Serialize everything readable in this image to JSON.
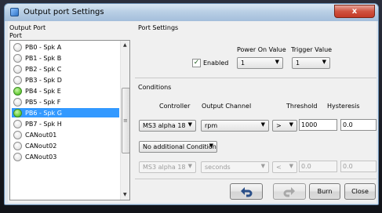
{
  "window": {
    "title": "Output port Settings",
    "close_glyph": "x"
  },
  "left": {
    "section_label": "Output Port",
    "list_label": "Port",
    "items": [
      {
        "label": "PB0 - Spk A",
        "active": false,
        "selected": false
      },
      {
        "label": "PB1 - Spk B",
        "active": false,
        "selected": false
      },
      {
        "label": "PB2 - Spk C",
        "active": false,
        "selected": false
      },
      {
        "label": "PB3 - Spk D",
        "active": false,
        "selected": false
      },
      {
        "label": "PB4 - Spk E",
        "active": true,
        "selected": false
      },
      {
        "label": "PB5 - Spk F",
        "active": false,
        "selected": false
      },
      {
        "label": "PB6 - Spk G",
        "active": true,
        "selected": true
      },
      {
        "label": "PB7 - Spk H",
        "active": false,
        "selected": false
      },
      {
        "label": "CANout01",
        "active": false,
        "selected": false
      },
      {
        "label": "CANout02",
        "active": false,
        "selected": false
      },
      {
        "label": "CANout03",
        "active": false,
        "selected": false
      }
    ],
    "scroll_up": "▲",
    "scroll_down": "▼",
    "scroll_grip": "≡"
  },
  "port_settings": {
    "section_label": "Port Settings",
    "power_on_label": "Power On Value",
    "trigger_label": "Trigger Value",
    "enabled_label": "Enabled",
    "enabled_checked": true,
    "power_on_value": "1",
    "trigger_value": "1"
  },
  "conditions": {
    "section_label": "Conditions",
    "col_controller": "Controller",
    "col_output_channel": "Output Channel",
    "col_threshold": "Threshold",
    "col_hysteresis": "Hysteresis",
    "row1": {
      "controller": "MS3 alpha 18",
      "channel": "rpm",
      "operator": ">",
      "threshold": "1000",
      "hysteresis": "0.0"
    },
    "additional": "No additional Condition",
    "row2": {
      "controller": "MS3 alpha 18",
      "channel": "seconds",
      "operator": "<",
      "threshold": "0.0",
      "hysteresis": "0.0"
    }
  },
  "buttons": {
    "undo_icon": "undo-icon",
    "redo_icon": "redo-icon",
    "burn": "Burn",
    "close": "Close"
  },
  "colors": {
    "selection": "#3399ff",
    "active_radio": "#6fd13f",
    "close_button": "#c33a27"
  }
}
